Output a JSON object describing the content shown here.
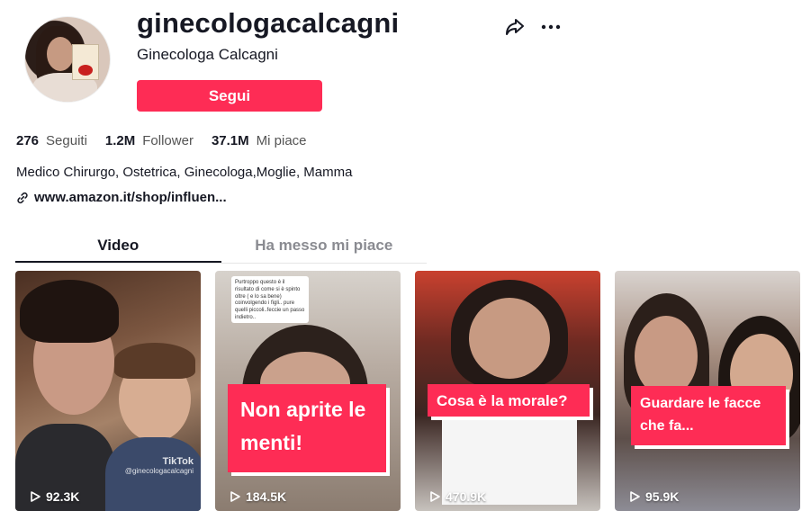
{
  "profile": {
    "username": "ginecologacalcagni",
    "nickname": "Ginecologa Calcagni",
    "follow_label": "Segui",
    "bio": "Medico Chirurgo, Ostetrica, Ginecologa,Moglie, Mamma",
    "link": "www.amazon.it/shop/influen..."
  },
  "stats": [
    {
      "num": "276",
      "label": "Seguiti"
    },
    {
      "num": "1.2M",
      "label": "Follower"
    },
    {
      "num": "37.1M",
      "label": "Mi piace"
    }
  ],
  "tabs": [
    {
      "label": "Video",
      "active": true
    },
    {
      "label": "Ha messo mi piace",
      "active": false
    }
  ],
  "videos": [
    {
      "views": "92.3K",
      "watermark": "TikTok",
      "watermark_handle": "@ginecologacalcagni"
    },
    {
      "views": "184.5K",
      "overlay_text": "Non aprite le menti!",
      "comment": "Purtroppo questo è il risultato di come si è spinto oltre ( e lo sa bene) coinvolgendo i figli.. pure quelli piccoli..feccie un passo indietro.."
    },
    {
      "views": "470.9K",
      "overlay_text": "Cosa è la morale?"
    },
    {
      "views": "95.9K",
      "overlay_text": "Guardare le facce che fa..."
    }
  ],
  "colors": {
    "accent": "#fe2c55",
    "text": "#161823",
    "muted": "#8a8b91"
  },
  "icons": {
    "share": "share-icon",
    "more": "more-icon",
    "link": "link-icon",
    "play": "play-icon"
  }
}
